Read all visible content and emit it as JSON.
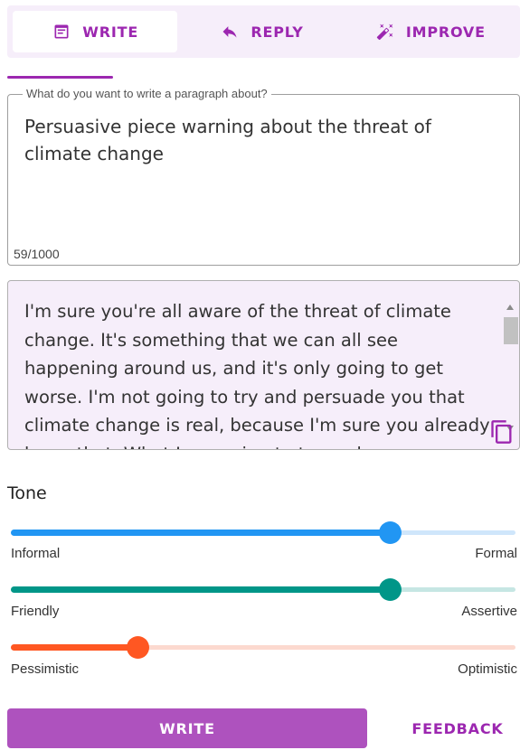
{
  "tabs": [
    {
      "label": "WRITE",
      "icon": "article-icon",
      "active": true
    },
    {
      "label": "REPLY",
      "icon": "reply-icon",
      "active": false
    },
    {
      "label": "IMPROVE",
      "icon": "magic-wand-icon",
      "active": false
    }
  ],
  "prompt": {
    "label": "What do you want to write a paragraph about?",
    "value": "Persuasive piece warning about the threat of climate change",
    "char_count": "59/1000"
  },
  "output": {
    "text": "I'm sure you're all aware of the threat of climate change. It's something that we can all see happening around us, and it's only going to get worse. I'm not going to try and persuade you that climate change is real, because I'm sure you already know that. What I am going to try and"
  },
  "tone": {
    "title": "Tone",
    "sliders": [
      {
        "left_label": "Informal",
        "right_label": "Formal",
        "value": 0.75,
        "color": "#2196f3",
        "rail_color": "#cfe6fb"
      },
      {
        "left_label": "Friendly",
        "right_label": "Assertive",
        "value": 0.75,
        "color": "#009688",
        "rail_color": "#c6e6e3"
      },
      {
        "left_label": "Pessimistic",
        "right_label": "Optimistic",
        "value": 0.25,
        "color": "#ff5722",
        "rail_color": "#fcd9cf"
      }
    ]
  },
  "actions": {
    "write_label": "WRITE",
    "feedback_label": "FEEDBACK"
  },
  "colors": {
    "accent": "#9c27b0",
    "tab_bar_bg": "#f6eefa",
    "write_button_bg": "#ae52be"
  }
}
